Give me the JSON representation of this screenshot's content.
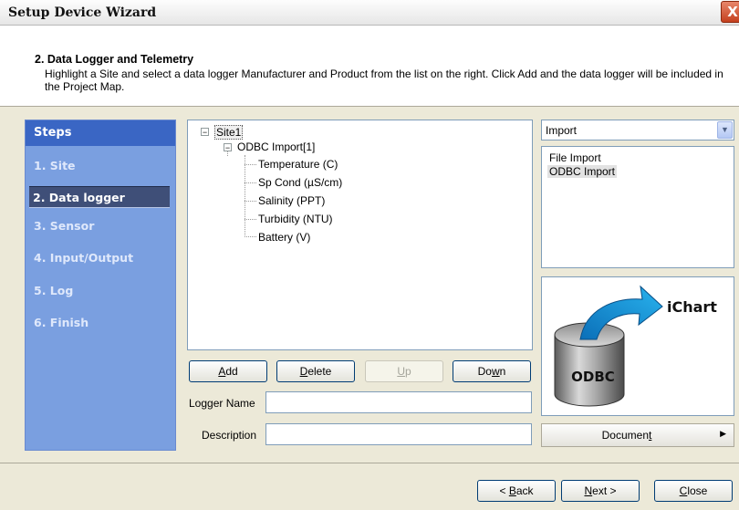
{
  "window": {
    "title": "Setup Device Wizard",
    "close_glyph": "X"
  },
  "header": {
    "heading": "2. Data Logger and Telemetry",
    "description": "Highlight a Site and select a data logger Manufacturer and Product from the list on the right. Click Add and the data logger will be included in the Project Map."
  },
  "steps": {
    "title": "Steps",
    "items": [
      {
        "label": "1. Site"
      },
      {
        "label": "2. Data logger",
        "active": true
      },
      {
        "label": "3. Sensor"
      },
      {
        "label": "4. Input/Output"
      },
      {
        "label": "5. Log"
      },
      {
        "label": "6. Finish"
      }
    ]
  },
  "tree": {
    "site": "Site1",
    "logger": "ODBC Import[1]",
    "channels": [
      "Temperature (C)",
      "Sp Cond (µS/cm)",
      "Salinity (PPT)",
      "Turbidity (NTU)",
      "Battery (V)"
    ]
  },
  "buttons": {
    "add": {
      "pre": "",
      "key": "A",
      "post": "dd"
    },
    "delete": {
      "pre": "",
      "key": "D",
      "post": "elete"
    },
    "up": {
      "pre": "",
      "key": "U",
      "post": "p"
    },
    "down": {
      "pre": "Do",
      "key": "w",
      "post": "n"
    }
  },
  "fields": {
    "logger_name_label": "Logger Name",
    "logger_name_value": "",
    "description_label": "Description",
    "description_value": ""
  },
  "import": {
    "selected": "Import",
    "options": [
      "File Import",
      "ODBC Import"
    ],
    "highlighted": "ODBC Import"
  },
  "image": {
    "top_text": "iChart",
    "cyl_text": "ODBC"
  },
  "document_button": {
    "pre": "Documen",
    "key": "t",
    "post": ""
  },
  "footer": {
    "back": {
      "pre": "< ",
      "key": "B",
      "post": "ack"
    },
    "next": {
      "pre": "",
      "key": "N",
      "post": "ext >"
    },
    "close": {
      "pre": "",
      "key": "C",
      "post": "lose"
    }
  },
  "colors": {
    "steps_bg": "#7a9fe0",
    "steps_header": "#3a66c4",
    "active_step": "#3f4f78",
    "arrow_blue": "#1e9be0"
  }
}
